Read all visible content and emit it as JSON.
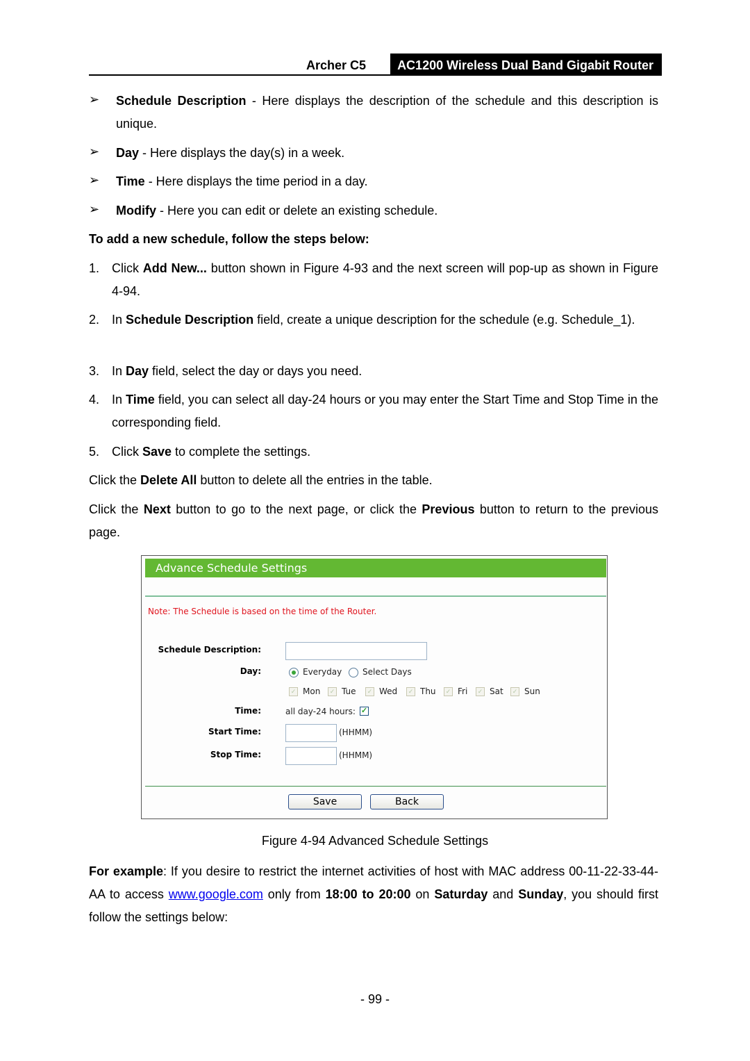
{
  "header": {
    "model": "Archer C5",
    "title": "AC1200 Wireless Dual Band Gigabit Router"
  },
  "bullets": [
    {
      "term": "Schedule Description",
      "text": " - Here displays the description of the schedule and this description is unique."
    },
    {
      "term": "Day",
      "text": " - Here displays the day(s) in a week."
    },
    {
      "term": "Time",
      "text": " - Here displays the time period in a day."
    },
    {
      "term": "Modify",
      "text": " - Here you can edit or delete an existing schedule."
    }
  ],
  "steps_heading": "To add a new schedule, follow the steps below:",
  "steps": [
    {
      "n": "1.",
      "a": "Click ",
      "b": "Add New...",
      "c": " button shown in Figure 4-93 and the next screen will pop-up as shown in Figure 4-94."
    },
    {
      "n": "2.",
      "a": "In ",
      "b": "Schedule Description",
      "c": " field, create a unique description for the schedule (e.g. Schedule_1)."
    },
    {
      "n": "3.",
      "a": "In ",
      "b": "Day",
      "c": " field, select the day or days you need."
    },
    {
      "n": "4.",
      "a": "In ",
      "b": "Time",
      "c": " field, you can select all day-24 hours or you may enter the Start Time and Stop Time in the corresponding field."
    },
    {
      "n": "5.",
      "a": "Click ",
      "b": "Save",
      "c": " to complete the settings."
    }
  ],
  "para1": {
    "a": "Click the ",
    "b": "Delete All",
    "c": " button to delete all the entries in the table."
  },
  "para2": {
    "a": "Click the ",
    "b": "Next",
    "c": " button to go to the next page, or click the ",
    "d": "Previous",
    "e": " button to return to the previous page."
  },
  "screenshot": {
    "title": "Advance Schedule Settings",
    "note": "Note: The Schedule is based on the time of the Router.",
    "labels": {
      "desc": "Schedule Description:",
      "day": "Day:",
      "time": "Time:",
      "start": "Start Time:",
      "stop": "Stop Time:"
    },
    "desc_value": "",
    "day_options": [
      "Everyday",
      "Select Days"
    ],
    "day_selected": "Everyday",
    "days": [
      "Mon",
      "Tue",
      "Wed",
      "Thu",
      "Fri",
      "Sat",
      "Sun"
    ],
    "all_day_label": "all day-24 hours:",
    "all_day_checked": true,
    "start_value": "",
    "stop_value": "",
    "hhmm": "(HHMM)",
    "save": "Save",
    "back": "Back"
  },
  "caption": "Figure 4-94 Advanced Schedule Settings",
  "example": {
    "a": "For example",
    "b": ": If you desire to restrict the internet activities of host with MAC address 00-11-22-33-44-AA to access ",
    "link": "www.google.com",
    "c": " only from ",
    "d": "18:00 to 20:00",
    "e": " on ",
    "f": "Saturday",
    "g": " and ",
    "h": "Sunday",
    "i": ", you should first follow the settings below:"
  },
  "page_number": "- 99 -"
}
